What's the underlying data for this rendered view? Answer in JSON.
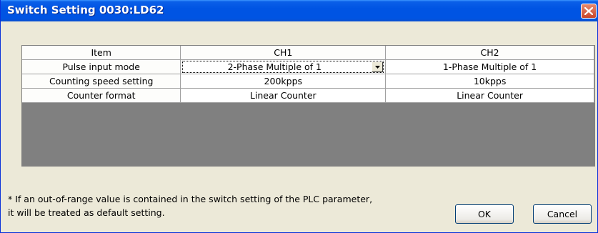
{
  "window": {
    "title": "Switch Setting 0030:LD62",
    "close_icon": "close-icon",
    "accent_color": "#0054e3",
    "close_color": "#c9462a"
  },
  "table": {
    "headers": [
      "Item",
      "CH1",
      "CH2"
    ],
    "rows": [
      {
        "item": "Pulse input mode",
        "ch1": "2-Phase Multiple of 1",
        "ch2": "1-Phase Multiple of 1"
      },
      {
        "item": "Counting speed setting",
        "ch1": "200kpps",
        "ch2": "10kpps"
      },
      {
        "item": "Counter format",
        "ch1": "Linear Counter",
        "ch2": "Linear Counter"
      }
    ],
    "active_dropdown_icon": "chevron-down-icon"
  },
  "note": {
    "line1": "* If an out-of-range value is contained in the switch setting of the PLC parameter,",
    "line2": "it will be treated as default setting."
  },
  "buttons": {
    "ok": "OK",
    "cancel": "Cancel"
  }
}
